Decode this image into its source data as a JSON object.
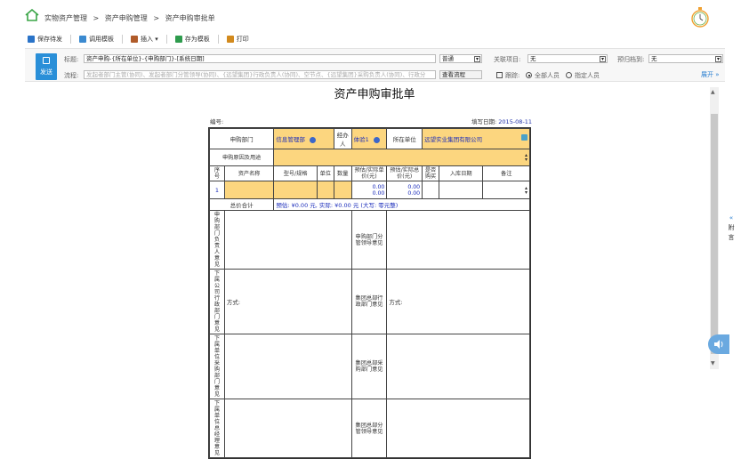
{
  "breadcrumb": [
    "实物资产管理",
    ">",
    "资产申购管理",
    ">",
    "资产申购审批单"
  ],
  "toolbar": {
    "items": [
      {
        "name": "save-draft-button",
        "icon": "save-icon",
        "label": "保存待发",
        "color": "#2a73c8"
      },
      {
        "name": "use-template-button",
        "icon": "template-icon",
        "label": "调用模板",
        "color": "#3b8ad0"
      },
      {
        "name": "insert-button",
        "icon": "paperclip-icon",
        "label": "插入 ▾",
        "color": "#b05b2a"
      },
      {
        "name": "save-as-template-button",
        "icon": "save-template-icon",
        "label": "存为模板",
        "color": "#2e9b4d"
      },
      {
        "name": "print-button",
        "icon": "print-icon",
        "label": "打印",
        "color": "#d28a1d"
      }
    ]
  },
  "header": {
    "send_label": "发送",
    "title_label": "标题:",
    "title_value": "资产申购-{所在单位}-{申购部门}-[系统日期]",
    "priority_value": "普通",
    "related_label": "关联项目:",
    "related_value": "无",
    "archive_label": "预归档到:",
    "archive_value": "无",
    "flow_label": "流程:",
    "flow_placeholder": "发起者部门主管(协同)、发起者部门分管领导(协同)、{远望集团}行政负责人(协同)、空节点、{远望集团}采购负责人(协同)、行政分",
    "view_flow_label": "查看流程",
    "trace_label": "跟踪:",
    "all_label": "全部人员",
    "specified_label": "指定人员",
    "expand_label": "展开"
  },
  "side": {
    "arrow": "«",
    "label1": "附",
    "label2": "言"
  },
  "doc": {
    "title": "资产申购审批单",
    "number_label": "编号:",
    "date_label": "填写日期:",
    "date_value": "2015-08-11",
    "dept_label": "申购部门",
    "dept_value": "信息管理部",
    "handler_label": "经办人",
    "handler_value": "体验1",
    "unit_label": "所在单位",
    "unit_value": "远望实业集团有限公司",
    "reason_label": "申购原因及用途",
    "col_no": "序号",
    "col_name": "资产名称",
    "col_model": "型号/规格",
    "col_unit": "单位",
    "col_qty": "数量",
    "col_est_price": "预估/实际单价(元)",
    "col_est_total": "预估/实际总价(元)",
    "col_stocked": "是否购买",
    "col_in_date": "入库日期",
    "col_remark": "备注",
    "row_no": "1",
    "row_price_a": "0.00",
    "row_price_b": "0.00",
    "row_total_a": "0.00",
    "row_total_b": "0.00",
    "total_label": "总价合计",
    "total_text": "预估: ¥0.00 元, 实际: ¥0.00 元 (大写: 零元整)",
    "dept_head_label": "申购部门负责人意见",
    "dept_leader_label": "申购部门分管领导意见",
    "sub_admin_label": "下属公司行政部门意见",
    "group_admin_label": "集团总部行政部门意见",
    "method_label": "方式:",
    "sub_purchase_label": "下属单位采购部门意见",
    "group_purchase_label": "集团总部采购部门意见",
    "sub_gm_label": "下属单位总经理意见",
    "group_leader_label": "集团总部分管领导意见"
  }
}
